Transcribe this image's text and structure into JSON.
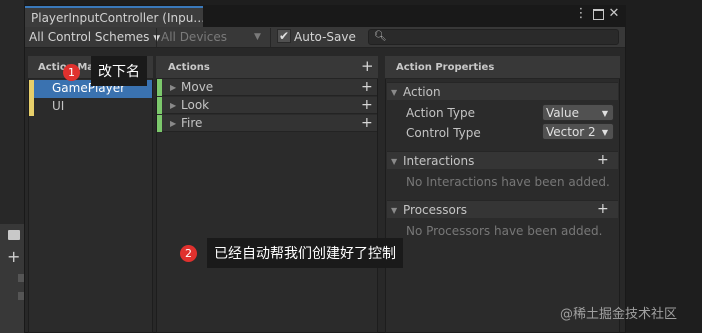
{
  "window": {
    "tab_title": "PlayerInputController (Inpu…",
    "buttons": [
      "kebab-menu-icon",
      "maximize-icon",
      "close-icon"
    ]
  },
  "toolbar": {
    "control_schemes": "All Control Schemes",
    "devices": "All Devices",
    "auto_save_label": "Auto-Save",
    "auto_save_checked": true,
    "search_placeholder": ""
  },
  "action_maps": {
    "header": "Action Maps",
    "items": [
      {
        "label": "GamePlayer",
        "selected": true
      },
      {
        "label": "UI",
        "selected": false
      }
    ]
  },
  "actions": {
    "header": "Actions",
    "items": [
      {
        "label": "Move"
      },
      {
        "label": "Look"
      },
      {
        "label": "Fire"
      }
    ]
  },
  "properties": {
    "header": "Action Properties",
    "action_section": "Action",
    "action_type_label": "Action Type",
    "action_type_value": "Value",
    "control_type_label": "Control Type",
    "control_type_value": "Vector 2",
    "interactions_section": "Interactions",
    "interactions_empty": "No Interactions have been added.",
    "processors_section": "Processors",
    "processors_empty": "No Processors have been added."
  },
  "annotations": [
    {
      "number": "1",
      "text": "改下名"
    },
    {
      "number": "2",
      "text": "已经自动帮我们创建好了控制"
    }
  ],
  "watermark": "@稀土掘金技术社区",
  "colors": {
    "selection": "#3a72b0",
    "action_map_marker": "#e7cf6a",
    "action_marker": "#7cc86c",
    "annotation_badge": "#e0312e"
  }
}
